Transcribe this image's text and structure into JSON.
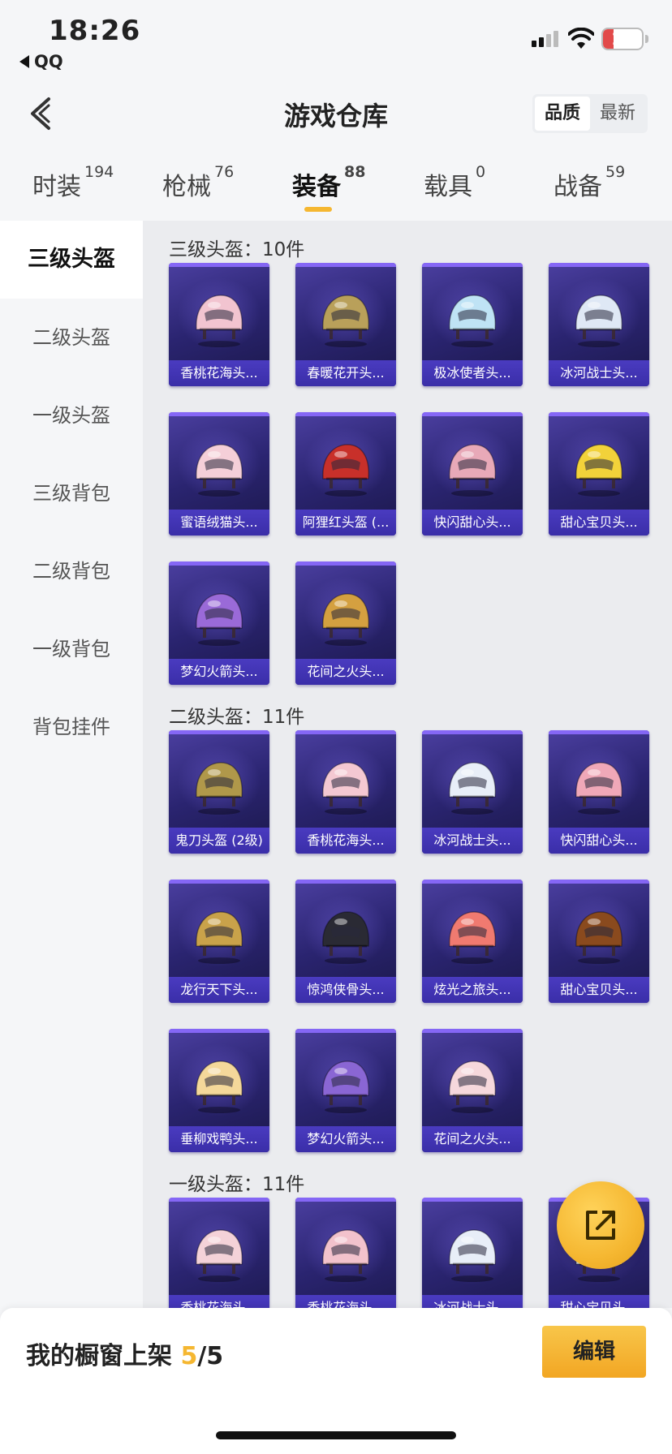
{
  "status_bar": {
    "time": "18:26",
    "back_app": "QQ",
    "battery": "12",
    "battery_level": 0.12
  },
  "header": {
    "title": "游戏仓库",
    "sort_options": [
      "品质",
      "最新"
    ],
    "active_sort": "品质"
  },
  "tabs": [
    {
      "label": "时装",
      "count": "194"
    },
    {
      "label": "枪械",
      "count": "76"
    },
    {
      "label": "装备",
      "count": "88",
      "active": true
    },
    {
      "label": "载具",
      "count": "0"
    },
    {
      "label": "战备",
      "count": "59"
    }
  ],
  "sidebar": {
    "items": [
      "三级头盔",
      "二级头盔",
      "一级头盔",
      "三级背包",
      "二级背包",
      "一级背包",
      "背包挂件"
    ],
    "active": "三级头盔"
  },
  "sections": [
    {
      "title": "三级头盔：10件",
      "items": [
        "香桃花海头...",
        "春暖花开头...",
        "极冰使者头...",
        "冰河战士头...",
        "蜜语绒猫头...",
        "阿狸红头盔 (...",
        "快闪甜心头...",
        "甜心宝贝头...",
        "梦幻火箭头...",
        "花间之火头..."
      ],
      "colors": [
        "#f2c4d0",
        "#b9a05a",
        "#bfe3f5",
        "#dfe8f5",
        "#f5cfd8",
        "#c8302a",
        "#e8a9b8",
        "#f2d23a",
        "#9a6ad8",
        "#d4a040"
      ]
    },
    {
      "title": "二级头盔：11件",
      "items": [
        "鬼刀头盔 (2级)",
        "香桃花海头...",
        "冰河战士头...",
        "快闪甜心头...",
        "龙行天下头...",
        "惊鸿侠骨头...",
        "炫光之旅头...",
        "甜心宝贝头...",
        "垂柳戏鸭头...",
        "梦幻火箭头...",
        "花间之火头..."
      ],
      "colors": [
        "#b0984a",
        "#f4c8d2",
        "#e8eef8",
        "#f0a8b8",
        "#c9a24a",
        "#2a2a34",
        "#f07a70",
        "#8a4a1e",
        "#f4d89a",
        "#8a66d4",
        "#f6d8dc"
      ]
    },
    {
      "title": "一级头盔：11件",
      "items": [
        "香桃花海头...",
        "香桃花海头...",
        "冰河战士头...",
        "甜心宝贝头..."
      ],
      "colors": [
        "#f4d2d8",
        "#f2c2cc",
        "#e8eef8",
        "#d8e4f4"
      ]
    }
  ],
  "bottom_bar": {
    "showcase_label": "我的橱窗上架",
    "showcase_current": "5",
    "showcase_total": "/5",
    "edit_label": "编辑"
  },
  "icons": [
    "back-chevron-icon",
    "share-out-icon",
    "wifi-icon",
    "signal-icon",
    "battery-icon"
  ],
  "accent_color": "#f5b731"
}
